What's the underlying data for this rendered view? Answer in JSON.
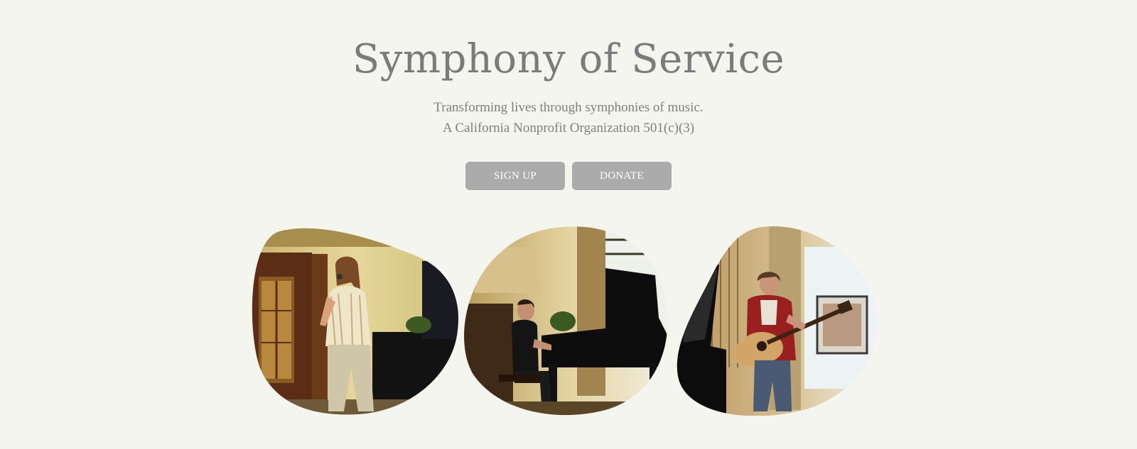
{
  "hero": {
    "title": "Symphony of Service",
    "tagline_line1": "Transforming lives through symphonies of music.",
    "tagline_line2": "A California Nonprofit Organization 501(c)(3)"
  },
  "buttons": {
    "signup_label": "SIGN UP",
    "donate_label": "DONATE"
  },
  "gallery": [
    {
      "subject": "singer performing with microphone beside grand piano"
    },
    {
      "subject": "pianist playing grand piano"
    },
    {
      "subject": "guitarist playing acoustic guitar"
    }
  ],
  "colors": {
    "background": "#f5f5f0",
    "title": "#7b7b7b",
    "button": "#ababab",
    "button_text": "#ffffff"
  }
}
